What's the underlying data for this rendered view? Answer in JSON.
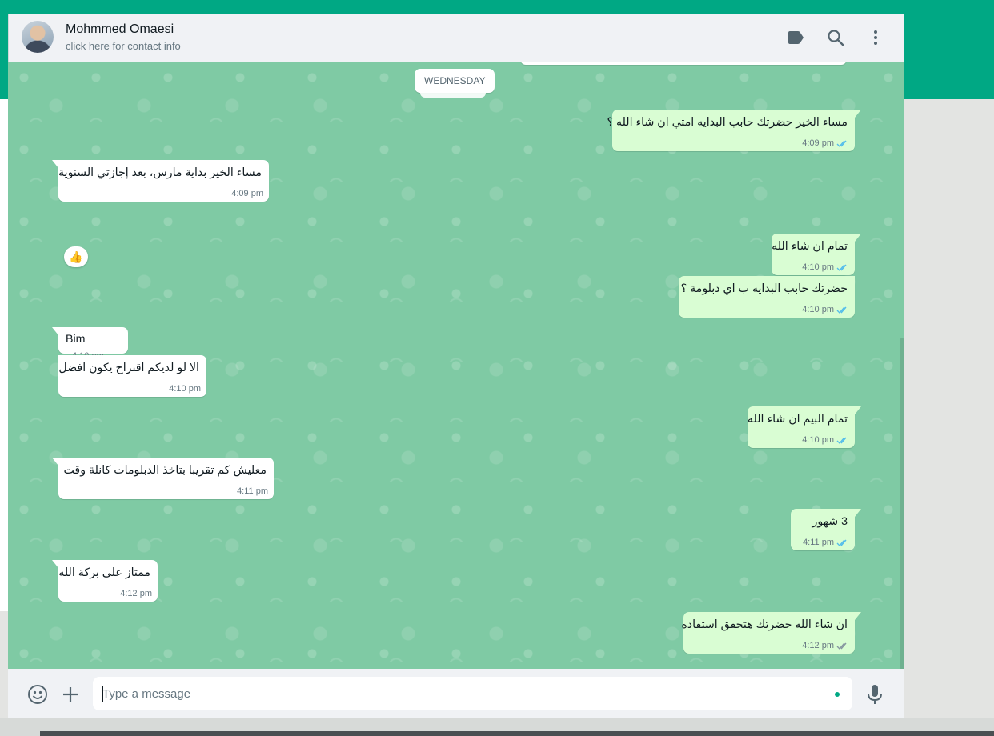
{
  "colors": {
    "brand": "#00a884",
    "chat_background": "#7fcaa4",
    "incoming_bubble": "#ffffff",
    "outgoing_bubble": "#d9fdd3",
    "read_ticks": "#53bdeb",
    "sent_ticks": "#8696a0"
  },
  "header": {
    "contact_name": "Mohmmed Omaesi",
    "contact_subtitle": "click here for contact info",
    "icons": [
      "label-icon",
      "search-icon",
      "menu-icon"
    ]
  },
  "chat": {
    "date_label": "WEDNESDAY",
    "messages": [
      {
        "direction": "out",
        "text": "مساء الخير حضرتك حابب البدايه امتي ان شاء الله ؟",
        "time": "4:09 pm",
        "status": "read"
      },
      {
        "direction": "in",
        "text": "مساء الخير بداية مارس، بعد إجازتي السنوية",
        "time": "4:09 pm",
        "reaction": "👍"
      },
      {
        "direction": "out",
        "text": "تمام ان شاء الله",
        "time": "4:10 pm",
        "status": "read"
      },
      {
        "direction": "out",
        "text": "حضرتك حابب البدايه ب اي دبلومة ؟",
        "time": "4:10 pm",
        "status": "read"
      },
      {
        "direction": "in",
        "text": "Bim",
        "time": "4:10 pm"
      },
      {
        "direction": "in",
        "text": "الا لو لديكم اقتراح يكون افضل",
        "time": "4:10 pm"
      },
      {
        "direction": "out",
        "text": "تمام البيم ان شاء الله",
        "time": "4:10 pm",
        "status": "read"
      },
      {
        "direction": "in",
        "text": "معليش كم تقريبا بتاخذ الدبلومات كانلة وقت",
        "time": "4:11 pm"
      },
      {
        "direction": "out",
        "text": "3 شهور",
        "time": "4:11 pm",
        "status": "read"
      },
      {
        "direction": "in",
        "text": "ممتاز على بركة الله",
        "time": "4:12 pm"
      },
      {
        "direction": "out",
        "text": "ان شاء الله حضرتك هتحقق استفاده",
        "time": "4:12 pm",
        "status": "delivered"
      }
    ]
  },
  "footer": {
    "placeholder": "Type a message",
    "value": "",
    "icons": [
      "emoji-icon",
      "attach-icon",
      "mic-icon"
    ]
  }
}
